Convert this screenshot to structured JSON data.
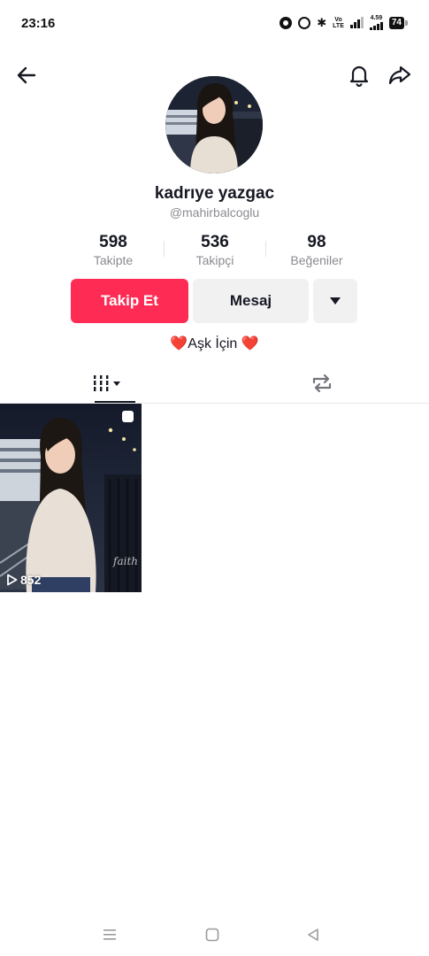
{
  "status_bar": {
    "time": "23:16",
    "battery": "74",
    "volte": [
      "Vo",
      "LTE"
    ],
    "speed": "4.59",
    "icons": [
      "data-saver-icon",
      "alarm-icon",
      "bluetooth-icon",
      "volte-icon",
      "signal-icon",
      "network-speed-icon",
      "battery-icon"
    ]
  },
  "header": {
    "icons": [
      "back-arrow-icon",
      "bell-icon",
      "share-icon"
    ]
  },
  "profile": {
    "display_name": "kadrıye yazgac",
    "username": "@mahirbalcoglu",
    "bio_text": "Aşk İçin",
    "bio_emoji": "❤️"
  },
  "stats": [
    {
      "value": "598",
      "label": "Takipte"
    },
    {
      "value": "536",
      "label": "Takipçi"
    },
    {
      "value": "98",
      "label": "Beğeniler"
    }
  ],
  "actions": {
    "follow_label": "Takip Et",
    "message_label": "Mesaj",
    "accent_color": "#fe2c55"
  },
  "tabs": [
    {
      "name": "videos",
      "icon": "grid-icon",
      "selected": true
    },
    {
      "name": "reposts",
      "icon": "repost-icon",
      "selected": false
    }
  ],
  "videos": [
    {
      "views": "852",
      "watermark": "faith"
    }
  ],
  "nav_bar": {
    "icons": [
      "menu-icon",
      "home-icon",
      "back-icon"
    ]
  }
}
